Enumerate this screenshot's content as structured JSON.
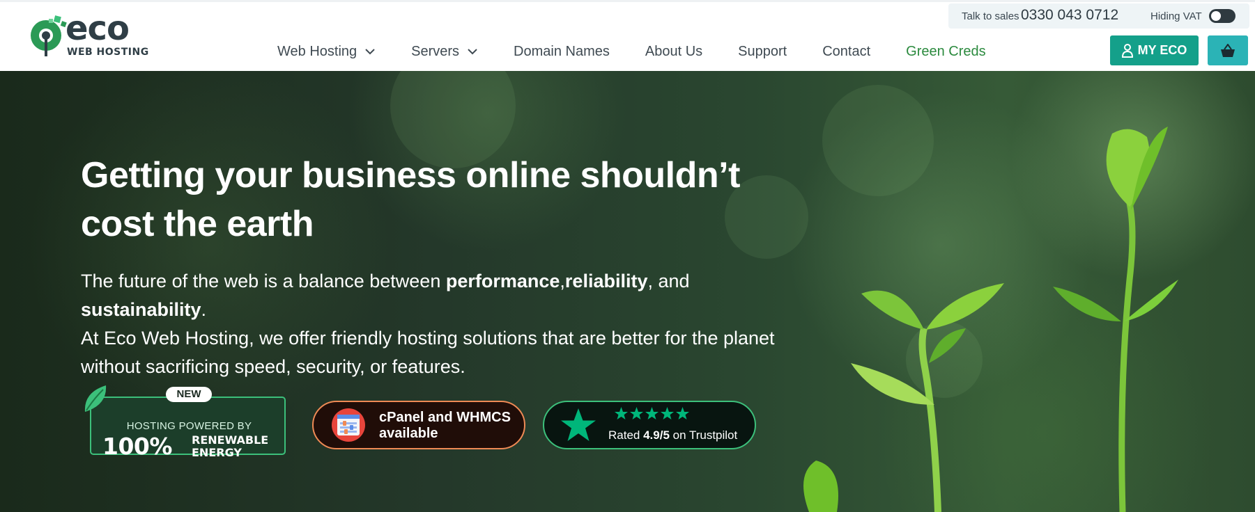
{
  "header": {
    "logo": {
      "word": "eco",
      "sub": "WEB HOSTING"
    },
    "topbar": {
      "talk_label": "Talk to sales",
      "phone": "0330 043 0712",
      "vat_label": "Hiding VAT",
      "vat_toggle_on": false
    },
    "nav": [
      {
        "label": "Web Hosting",
        "dropdown": true
      },
      {
        "label": "Servers",
        "dropdown": true
      },
      {
        "label": "Domain Names",
        "dropdown": false
      },
      {
        "label": "About Us",
        "dropdown": false
      },
      {
        "label": "Support",
        "dropdown": false
      },
      {
        "label": "Contact",
        "dropdown": false
      },
      {
        "label": "Green Creds",
        "dropdown": false,
        "color": "#2b8a3e"
      }
    ],
    "myeco_label": "MY ECO",
    "cart_icon": "basket-icon"
  },
  "hero": {
    "title_line1": "Getting your business online shouldn’t",
    "title_line2": "cost the earth",
    "text": {
      "p1_a": "The future of the web is a balance between ",
      "p1_b1": "performance",
      "p1_c": ",",
      "p1_b2": "reliability",
      "p1_d": ", and ",
      "p1_b3": "sustainability",
      "p1_e": ".",
      "line2": "At Eco Web Hosting, we offer friendly hosting solutions that are better for the planet",
      "line3": "without sacrificing speed, security, or features."
    },
    "badges": {
      "renewable": {
        "new": "NEW",
        "line1": "HOSTING POWERED BY",
        "pct": "100%",
        "word1": "RENEWABLE",
        "word2": "ENERGY"
      },
      "cpanel": {
        "line1": "cPanel and WHMCS",
        "line2": "available"
      },
      "trustpilot": {
        "stars": 5,
        "rated": "Rated ",
        "score": "4.9/5",
        "suffix": " on Trustpilot"
      }
    }
  },
  "colors": {
    "brand_teal": "#14a08a",
    "cart_teal": "#2bb3b6",
    "green_link": "#2b8a3e",
    "trustpilot_green": "#00b67a",
    "cpanel_orange": "#ef8a55"
  }
}
